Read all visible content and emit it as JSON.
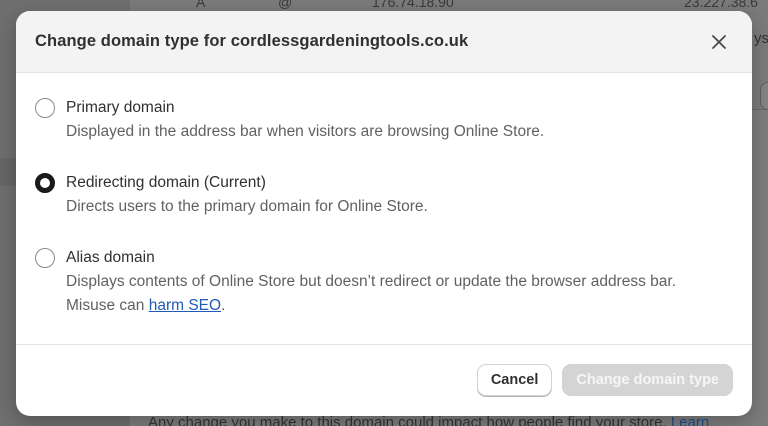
{
  "background": {
    "row_values": [
      "A",
      "@",
      "176.74.18.90",
      "23.227.38.6"
    ],
    "side_text": "ysh",
    "bottom_text": "Any change you make to this domain could impact how people find your store.",
    "bottom_link": "Learn"
  },
  "modal": {
    "title": "Change domain type for cordlessgardeningtools.co.uk",
    "close_icon": "close-icon",
    "options": [
      {
        "label": "Primary domain",
        "description": "Displayed in the address bar when visitors are browsing Online Store.",
        "selected": false
      },
      {
        "label": "Redirecting domain (Current)",
        "description": "Directs users to the primary domain for Online Store.",
        "selected": true
      },
      {
        "label": "Alias domain",
        "description": "Displays contents of Online Store but doesn’t redirect or update the browser address bar.",
        "description_2_prefix": "Misuse can",
        "description_link": "harm SEO",
        "description_2_suffix": ".",
        "selected": false
      }
    ],
    "cancel_label": "Cancel",
    "submit_label": "Change domain type"
  },
  "colors": {
    "overlay": "#7a7a7a",
    "link": "#1f5bb8",
    "disabled_button": "#d4d4d4"
  }
}
